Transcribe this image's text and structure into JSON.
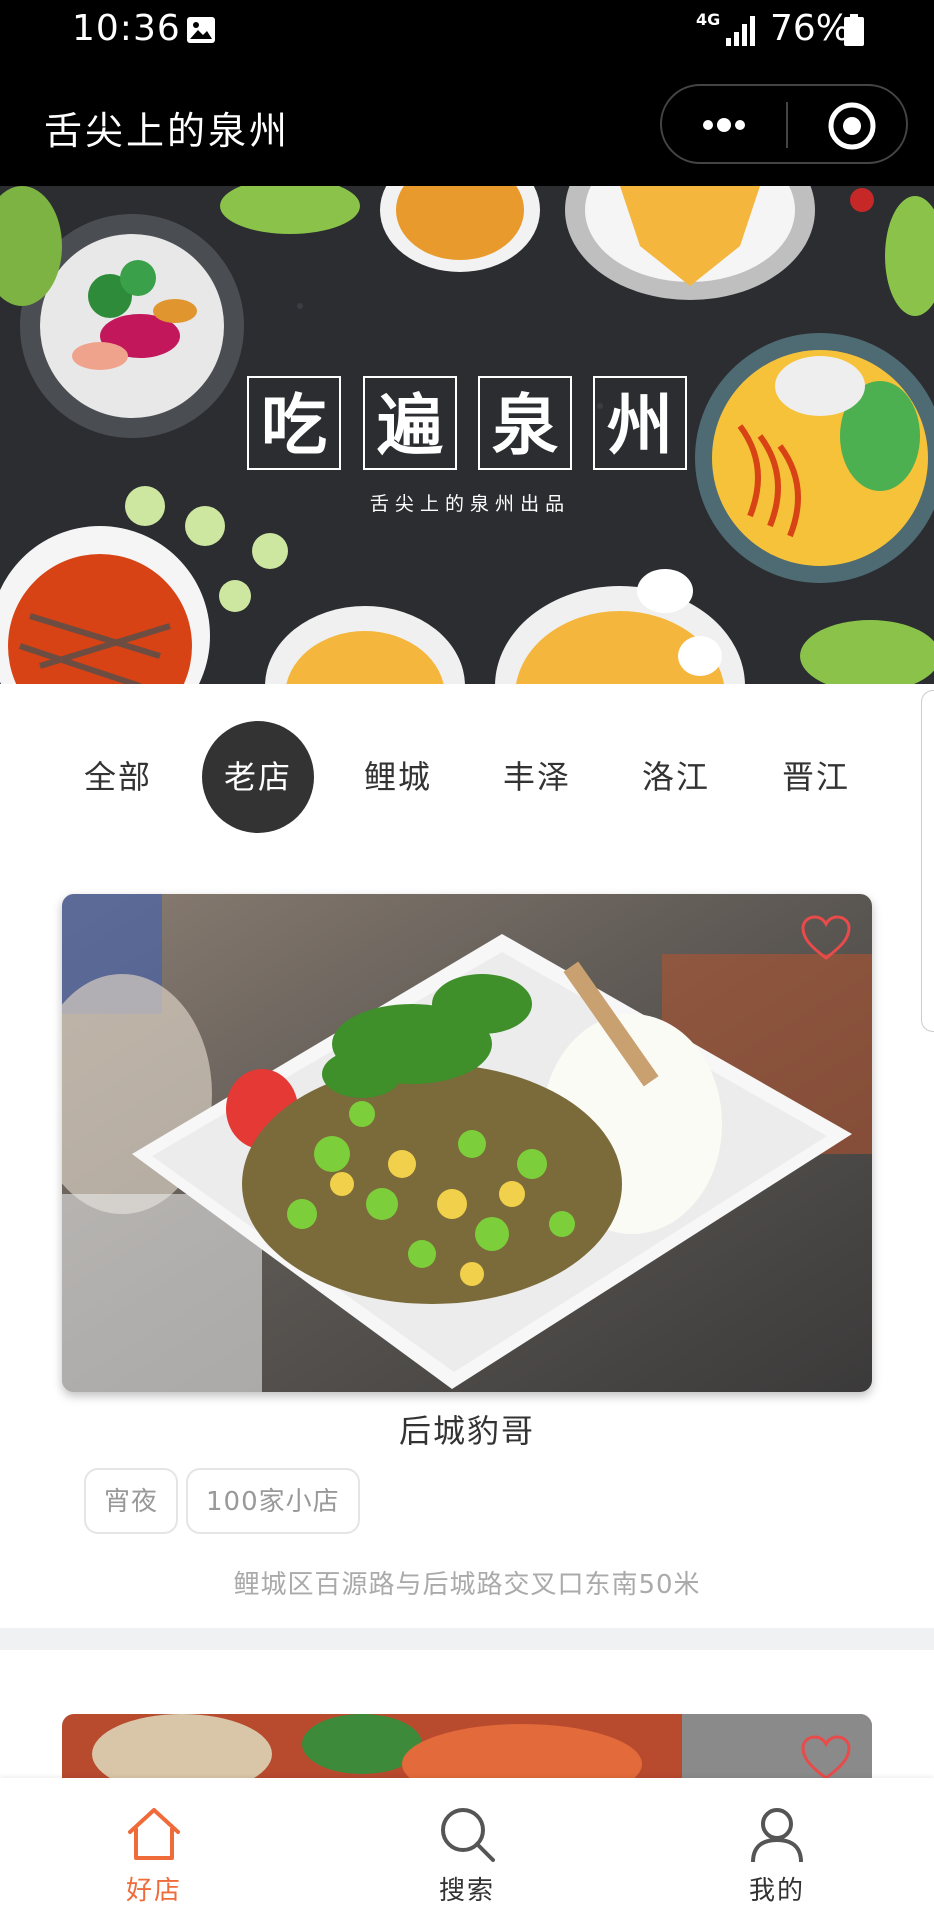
{
  "status_bar": {
    "time": "10:36",
    "network": "4G",
    "battery": "76%"
  },
  "nav_bar": {
    "title": "舌尖上的泉州"
  },
  "banner": {
    "headline_chars": [
      "吃",
      "遍",
      "泉",
      "州"
    ],
    "subtitle": "舌 尖 上 的 泉 州 出 品"
  },
  "tabs": [
    {
      "label": "全部",
      "active": false
    },
    {
      "label": "老店",
      "active": true
    },
    {
      "label": "鲤城",
      "active": false
    },
    {
      "label": "丰泽",
      "active": false
    },
    {
      "label": "洛江",
      "active": false
    },
    {
      "label": "晋江",
      "active": false
    }
  ],
  "shops": [
    {
      "name": "后城豹哥",
      "tags": [
        "宵夜",
        "100家小店"
      ],
      "address": "鲤城区百源路与后城路交叉口东南50米"
    }
  ],
  "tab_bar": [
    {
      "label": "好店",
      "icon": "home-icon",
      "active": true
    },
    {
      "label": "搜索",
      "icon": "search-icon",
      "active": false
    },
    {
      "label": "我的",
      "icon": "user-icon",
      "active": false
    }
  ],
  "colors": {
    "accent": "#ef6c3a",
    "heart": "#e94a4a",
    "active_tab_bg": "#333333",
    "banner_bg": "#2a2c30"
  }
}
